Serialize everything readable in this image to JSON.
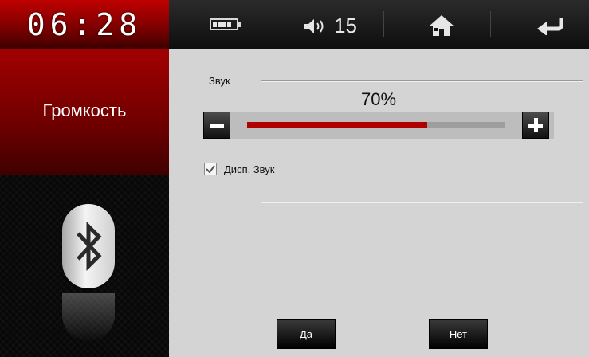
{
  "status_bar": {
    "clock": "06:28",
    "volume_level": "15",
    "icons": [
      "battery-icon",
      "speaker-icon",
      "home-icon",
      "back-arrow-icon"
    ]
  },
  "left_panel": {
    "title": "Громкость",
    "bluetooth_icon": "bluetooth-icon"
  },
  "sound": {
    "section_label": "Звук",
    "percent_text": "70%",
    "level_fraction": 0.7,
    "minus_icon": "minus-icon",
    "plus_icon": "plus-icon",
    "display_checkbox": {
      "label": "Дисп. Звук",
      "checked": true
    }
  },
  "dialog": {
    "yes_label": "Да",
    "no_label": "Нет"
  },
  "colors": {
    "accent_red": "#b00000",
    "track_gray": "#9e9e9e"
  }
}
